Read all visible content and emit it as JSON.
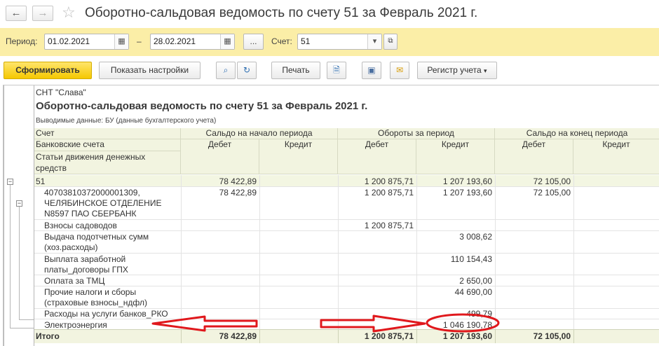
{
  "window": {
    "back_icon": "arrow-left-icon",
    "forward_icon": "arrow-right-icon",
    "favorite_icon": "star-icon",
    "title": "Оборотно-сальдовая ведомость по счету 51 за Февраль 2021 г."
  },
  "params": {
    "period_label": "Период:",
    "date_from": "01.02.2021",
    "dash": "–",
    "date_to": "28.02.2021",
    "ellipsis": "...",
    "account_label": "Счет:",
    "account_value": "51"
  },
  "toolbar": {
    "generate": "Сформировать",
    "show_settings": "Показать настройки",
    "print": "Печать",
    "register": "Регистр учета"
  },
  "report": {
    "org": "СНТ \"Слава\"",
    "title": "Оборотно-сальдовая ведомость по счету 51 за Февраль 2021 г.",
    "output_data": "Выводимые данные:  БУ (данные бухгалтерского учета)",
    "headers": {
      "account": "Счет",
      "bank_accounts": "Банковские счета",
      "cash_flow_1": "Статьи движения денежных",
      "cash_flow_2": "средств",
      "opening": "Сальдо на начало периода",
      "turnover": "Обороты за период",
      "closing": "Сальдо на конец периода",
      "debit": "Дебет",
      "credit": "Кредит"
    },
    "rows": [
      {
        "name": "51",
        "open_debit": "78 422,89",
        "turn_debit": "1 200 875,71",
        "turn_credit": "1 207 193,60",
        "close_debit": "72 105,00"
      },
      {
        "name_1": "40703810372000001309,",
        "name_2": "ЧЕЛЯБИНСКОЕ ОТДЕЛЕНИЕ",
        "name_3": "N8597 ПАО СБЕРБАНК",
        "open_debit": "78 422,89",
        "turn_debit": "1 200 875,71",
        "turn_credit": "1 207 193,60",
        "close_debit": "72 105,00"
      },
      {
        "name": "Взносы садоводов",
        "turn_debit": "1 200 875,71"
      },
      {
        "name_1": "Выдача подотчетных сумм",
        "name_2": "(хоз.расходы)",
        "turn_credit": "3 008,62"
      },
      {
        "name_1": "Выплата заработной",
        "name_2": "платы_договоры ГПХ",
        "turn_credit": "110 154,43"
      },
      {
        "name": "Оплата за ТМЦ",
        "turn_credit": "2 650,00"
      },
      {
        "name_1": "Прочие налоги и сборы",
        "name_2": "(страховые взносы_ндфл)",
        "turn_credit": "44 690,00"
      },
      {
        "name": "Расходы на услуги банков_РКО",
        "turn_credit": "499,79"
      },
      {
        "name": "Электроэнергия",
        "turn_credit": "1 046 190,78"
      }
    ],
    "totals": {
      "label": "Итого",
      "open_debit": "78 422,89",
      "turn_debit": "1 200 875,71",
      "turn_credit": "1 207 193,60",
      "close_debit": "72 105,00"
    },
    "annotation_color": "#e0181c"
  }
}
